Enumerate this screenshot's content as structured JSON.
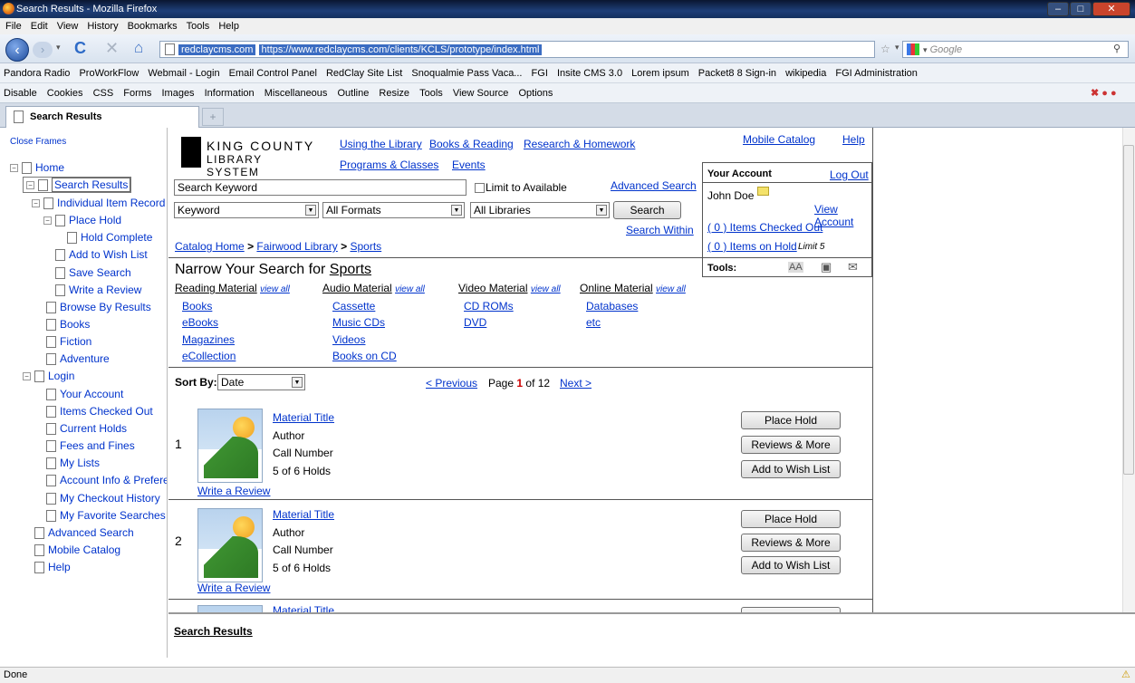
{
  "browser": {
    "window_title": "Search Results - Mozilla Firefox",
    "menu": [
      "File",
      "Edit",
      "View",
      "History",
      "Bookmarks",
      "Tools",
      "Help"
    ],
    "url_domain": "redclaycms.com",
    "url": "https://www.redclaycms.com/clients/KCLS/prototype/index.html",
    "search_placeholder": "Google",
    "bookmarks": [
      "Pandora Radio",
      "ProWorkFlow",
      "Webmail - Login",
      "Email Control Panel",
      "RedClay Site List",
      "Snoqualmie Pass Vaca...",
      "FGI",
      "Insite CMS 3.0",
      "Lorem ipsum",
      "Packet8 8 Sign-in",
      "wikipedia",
      "FGI Administration"
    ],
    "devtools": [
      "Disable",
      "Cookies",
      "CSS",
      "Forms",
      "Images",
      "Information",
      "Miscellaneous",
      "Outline",
      "Resize",
      "Tools",
      "View Source",
      "Options"
    ],
    "tab_title": "Search Results",
    "status": "Done"
  },
  "sidebar": {
    "close_frames": "Close Frames",
    "items": [
      "Home",
      "Search Results",
      "Individual Item Record",
      "Place Hold",
      "Hold Complete",
      "Add to Wish List",
      "Save Search",
      "Write a Review",
      "Browse By Results",
      "Books",
      "Fiction",
      "Adventure",
      "Login",
      "Your Account",
      "Items Checked Out",
      "Current Holds",
      "Fees and Fines",
      "My Lists",
      "Account Info & Prefere",
      "My Checkout History",
      "My Favorite Searches",
      "Advanced Search",
      "Mobile Catalog",
      "Help"
    ]
  },
  "page": {
    "logo_line1": "KING COUNTY",
    "logo_line2": "LIBRARY SYSTEM",
    "nav": [
      "Using the Library",
      "Books & Reading",
      "Research & Homework",
      "Programs & Classes",
      "Events"
    ],
    "mobile_catalog": "Mobile Catalog",
    "help": "Help",
    "search_value": "Search Keyword",
    "limit_available": "Limit to Available",
    "advanced_search": "Advanced Search",
    "search_type": "Keyword",
    "formats": "All Formats",
    "libraries": "All Libraries",
    "search_button": "Search",
    "search_within": "Search Within",
    "breadcrumb": [
      "Catalog Home",
      "Fairwood Library",
      "Sports"
    ],
    "breadcrumb_sep": ">",
    "account": {
      "title": "Your Account",
      "logout": "Log Out",
      "user": "John Doe",
      "view_account": "View Account",
      "checked_out": "( 0 ) Items Checked Out",
      "on_hold": "( 0 ) Items on Hold",
      "limit": "Limit 5",
      "tools": "Tools:"
    },
    "narrow_title": "Narrow Your Search for",
    "narrow_term": "Sports",
    "view_all": "view all",
    "facets": [
      {
        "heading": "Reading Material",
        "items": [
          "Books",
          "eBooks",
          "Magazines",
          "eCollection"
        ]
      },
      {
        "heading": "Audio Material",
        "items": [
          "Cassette",
          "Music CDs",
          "Videos",
          "Books on CD"
        ]
      },
      {
        "heading": "Video Material",
        "items": [
          "CD ROMs",
          "DVD"
        ]
      },
      {
        "heading": "Online Material",
        "items": [
          "Databases",
          "etc"
        ]
      }
    ],
    "sort_label": "Sort By:",
    "sort_value": "Date",
    "prev": "< Previous",
    "page_word": "Page",
    "page_num": "1",
    "of_total": "of 12",
    "next": "Next >",
    "results": [
      {
        "num": "1",
        "title": "Material Title",
        "author": "Author",
        "call": "Call Number",
        "holds": "5 of 6 Holds",
        "review": "Write a Review"
      },
      {
        "num": "2",
        "title": "Material Title",
        "author": "Author",
        "call": "Call Number",
        "holds": "5 of 6 Holds",
        "review": "Write a Review"
      },
      {
        "num": "",
        "title": "Material Title",
        "author": "",
        "call": "",
        "holds": "",
        "review": ""
      }
    ],
    "place_hold": "Place Hold",
    "reviews_more": "Reviews & More",
    "add_wish": "Add to Wish List"
  },
  "bottom_frame": {
    "label": "Search Results"
  }
}
